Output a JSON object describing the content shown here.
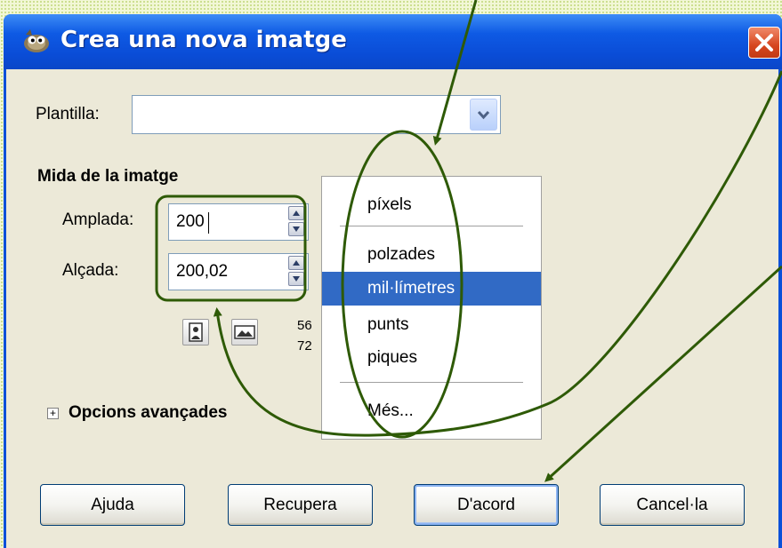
{
  "window": {
    "title": "Crea una nova imatge",
    "close_label": "×"
  },
  "template": {
    "label": "Plantilla:",
    "value": ""
  },
  "image_size": {
    "section_title": "Mida de la imatge",
    "width_label": "Amplada:",
    "width_value": "200",
    "height_label": "Alçada:",
    "height_value": "200,02",
    "res_line1": "56",
    "res_line2": "72"
  },
  "unit_menu": {
    "items": [
      "píxels",
      "polzades",
      "mil·límetres",
      "punts",
      "piques",
      "Més..."
    ],
    "selected": "mil·límetres"
  },
  "advanced": {
    "label": "Opcions avançades",
    "expander": "+"
  },
  "buttons": {
    "help": "Ajuda",
    "reset": "Recupera",
    "ok": "D'acord",
    "cancel": "Cancel·la"
  },
  "colors": {
    "titlebar": "#0a50d9",
    "dialog_bg": "#ece9d8",
    "selection": "#316ac5",
    "annotation": "#2e5a06"
  },
  "icons": {
    "app": "gimp-wilber-icon",
    "close": "close-icon",
    "combo": "chevron-down-icon",
    "spin": "spin-arrows-icon",
    "portrait": "portrait-orientation-icon",
    "landscape": "landscape-orientation-icon"
  }
}
